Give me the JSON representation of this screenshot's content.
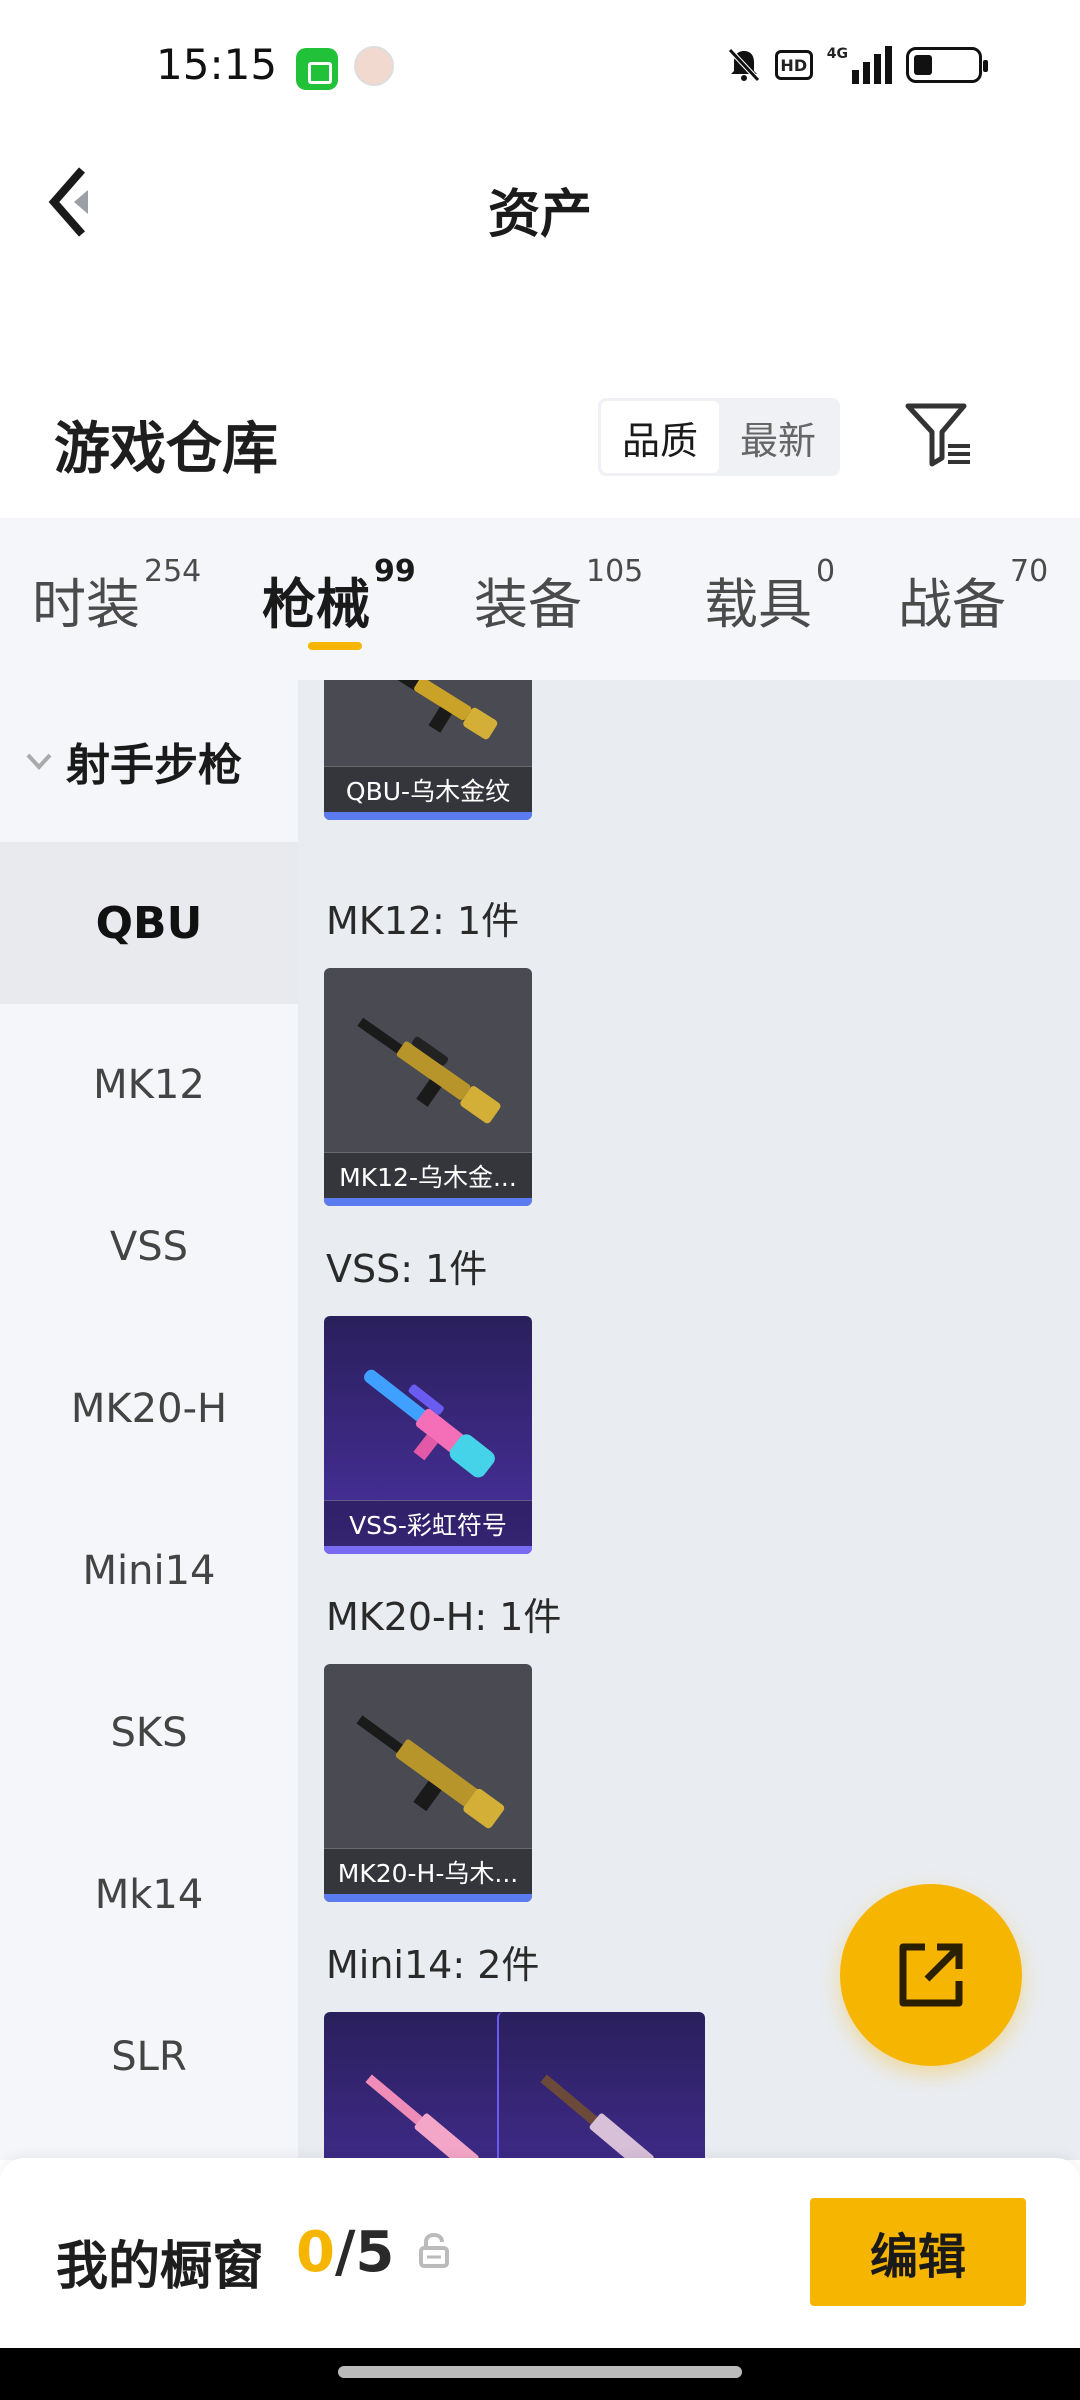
{
  "status_bar": {
    "time": "15:15",
    "hd": "HD",
    "network": "4G"
  },
  "header": {
    "title": "资产"
  },
  "warehouse": {
    "title": "游戏仓库",
    "sort_options": [
      "品质",
      "最新"
    ],
    "active_sort": "品质"
  },
  "tabs": [
    {
      "label": "时装",
      "count": "254"
    },
    {
      "label": "枪械",
      "count": "99"
    },
    {
      "label": "装备",
      "count": "105"
    },
    {
      "label": "载具",
      "count": "0"
    },
    {
      "label": "战备",
      "count": "70"
    }
  ],
  "active_tab": "枪械",
  "sidebar": {
    "group": "射手步枪",
    "items": [
      "QBU",
      "MK12",
      "VSS",
      "MK20-H",
      "Mini14",
      "SKS",
      "Mk14",
      "SLR"
    ],
    "active_item": "QBU"
  },
  "content": {
    "cards": [
      {
        "caption": "QBU-乌木金纹"
      },
      {
        "caption": "MK12-乌木金..."
      },
      {
        "caption": "VSS-彩虹符号"
      },
      {
        "caption": "MK20-H-乌木..."
      }
    ],
    "groups": [
      {
        "label": "MK12: 1件"
      },
      {
        "label": "VSS: 1件"
      },
      {
        "label": "MK20-H: 1件"
      },
      {
        "label": "Mini14: 2件"
      }
    ]
  },
  "showcase": {
    "label": "我的橱窗",
    "current": "0",
    "separator": "/",
    "total": "5",
    "edit_label": "编辑"
  },
  "colors": {
    "accent": "#f6b500",
    "rarity_blue": "#5b7cf0",
    "rarity_purple": "#7a6cf2"
  }
}
